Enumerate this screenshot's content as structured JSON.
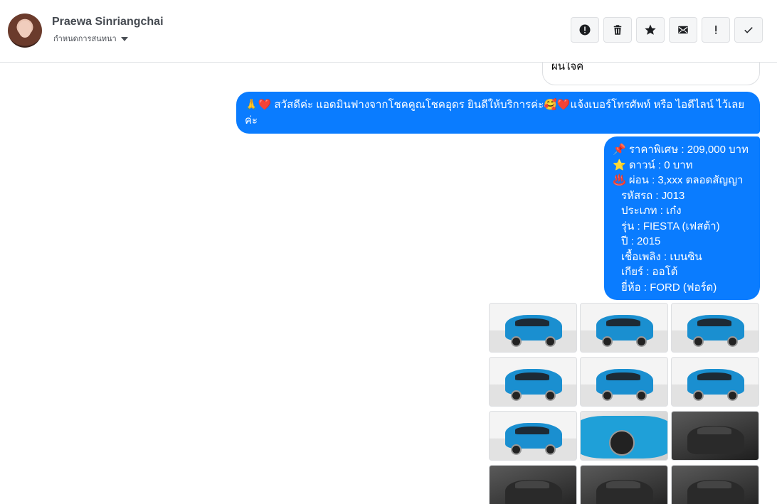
{
  "header": {
    "name": "Praewa Sinriangchai",
    "subtitle": "กำหนดการสนทนา"
  },
  "actions": [
    {
      "name": "report-button",
      "icon": "alert-circle-icon"
    },
    {
      "name": "delete-button",
      "icon": "trash-icon"
    },
    {
      "name": "star-button",
      "icon": "star-icon"
    },
    {
      "name": "mail-button",
      "icon": "envelope-icon"
    },
    {
      "name": "important-button",
      "icon": "exclamation-icon"
    },
    {
      "name": "done-button",
      "icon": "check-icon"
    }
  ],
  "messages": {
    "previous_partial": "ผนใจค่",
    "greeting": "🙏❤️ สวัสดีค่ะ แอดมินฟางจากโชคคูณโชคอุดร ยินดีให้บริการค่ะ🥰❤️แจ้งเบอร์โทรศัพท์ หรือ ไอดีไลน์  ไว้เลยค่ะ",
    "details": [
      "📌 ราคาพิเศษ : 209,000 บาท",
      "⭐ ดาวน์ : 0 บาท",
      "♨️ ผ่อน : 3,xxx ตลอดสัญญา",
      "รหัสรถ : J013",
      "ประเภท : เก๋ง",
      "รุ่น : FIESTA (เฟสต้า)",
      "ปี : 2015",
      "เชื้อเพลิง : เบนซิน",
      "เกียร์ : ออโต้",
      "ยี่ห้อ : FORD (ฟอร์ด)"
    ]
  },
  "photos": [
    "car-front-left-photo",
    "car-front-photo",
    "car-front-right-photo",
    "car-rear-left-photo",
    "car-rear-photo",
    "car-rear-right-photo",
    "car-side-photo",
    "car-wheel-photo",
    "car-door-interior-photo",
    "car-dashboard-photo",
    "car-console-photo",
    "car-steering-photo"
  ],
  "colors": {
    "bubble": "#0a7cff",
    "border": "#dddfe2",
    "button_bg": "#f5f6f7"
  }
}
